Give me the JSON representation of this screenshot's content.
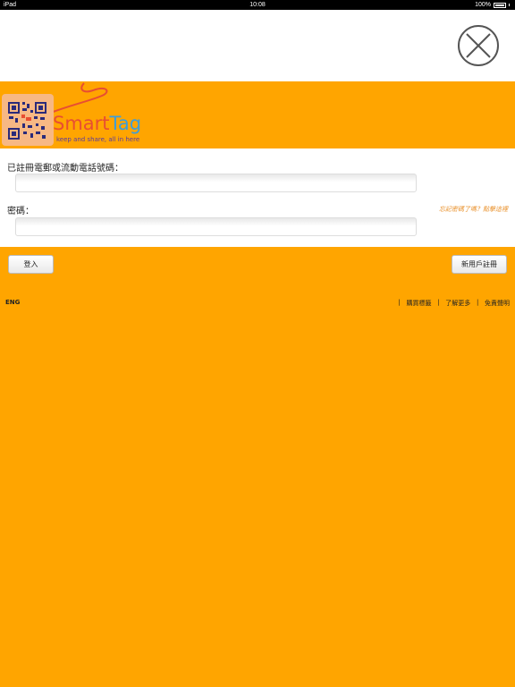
{
  "status_bar": {
    "device": "iPad",
    "time": "10:08",
    "battery": "100%"
  },
  "header": {
    "close_icon": "close-x-circle-icon"
  },
  "brand": {
    "name_part1": "Smart",
    "name_part2": "Tag",
    "tagline": "keep and share, all in here",
    "logo_icon": "qr-code-logo-icon",
    "colors": {
      "accent_orange": "#FFA500",
      "smart_red": "#E84E32",
      "tag_blue": "#3C9DDB"
    }
  },
  "form": {
    "account_label": "已註冊電郵或流動電話號碼：",
    "account_value": "",
    "password_label": "密碼：",
    "password_value": "",
    "forgot_link": "忘記密碼了嗎？點擊這裡"
  },
  "actions": {
    "login_label": "登入",
    "register_label": "新用戶註冊"
  },
  "footer": {
    "language": "ENG",
    "separator": "|",
    "links": [
      "購買標籤",
      "了解更多",
      "免責聲明"
    ]
  }
}
